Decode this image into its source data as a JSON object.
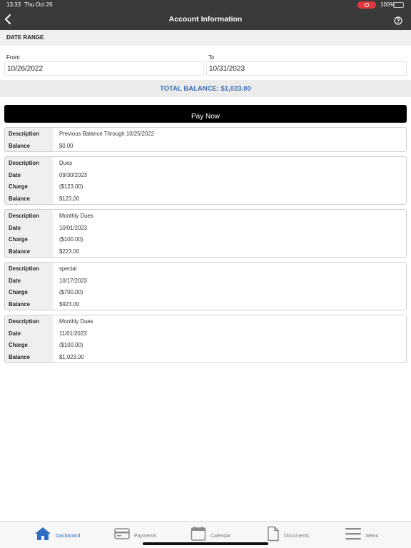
{
  "status": {
    "time": "13:33",
    "day": "Thu Oct 26",
    "battery": "100%"
  },
  "header": {
    "title": "Account Information"
  },
  "date_range": {
    "label": "DATE RANGE",
    "from_label": "From",
    "from_value": "10/26/2022",
    "to_label": "To",
    "to_value": "10/31/2023"
  },
  "total_balance": "TOTAL BALANCE: $1,023.00",
  "pay_now": "Pay Now",
  "transactions": [
    {
      "rows": [
        {
          "k": "Description",
          "v": "Previous Balance Through 10/25/2022"
        },
        {
          "k": "Balance",
          "v": "$0.00"
        }
      ]
    },
    {
      "rows": [
        {
          "k": "Description",
          "v": "Dues"
        },
        {
          "k": "Date",
          "v": "09/30/2023"
        },
        {
          "k": "Charge",
          "v": "($123.00)"
        },
        {
          "k": "Balance",
          "v": "$123.00"
        }
      ]
    },
    {
      "rows": [
        {
          "k": "Description",
          "v": "Monthly Dues"
        },
        {
          "k": "Date",
          "v": "10/01/2023"
        },
        {
          "k": "Charge",
          "v": "($100.00)"
        },
        {
          "k": "Balance",
          "v": "$223.00"
        }
      ]
    },
    {
      "rows": [
        {
          "k": "Description",
          "v": "special"
        },
        {
          "k": "Date",
          "v": "10/17/2023"
        },
        {
          "k": "Charge",
          "v": "($700.00)"
        },
        {
          "k": "Balance",
          "v": "$923.00"
        }
      ]
    },
    {
      "rows": [
        {
          "k": "Description",
          "v": "Monthly Dues"
        },
        {
          "k": "Date",
          "v": "11/01/2023"
        },
        {
          "k": "Charge",
          "v": "($100.00)"
        },
        {
          "k": "Balance",
          "v": "$1,023.00"
        }
      ]
    }
  ],
  "tabs": {
    "dashboard": "Dashboard",
    "payments": "Payments",
    "calendar": "Calendar",
    "documents": "Documents",
    "menu": "Menu"
  },
  "colors": {
    "accent": "#2f6cc2",
    "total": "#3a6fb5",
    "header": "#3a3a3a",
    "battery": "#3ccf4e",
    "record": "#e0383e"
  },
  "icons": [
    "back-chevron-icon",
    "help-icon",
    "home-icon",
    "credit-card-icon",
    "calendar-icon",
    "document-icon",
    "menu-icon"
  ]
}
